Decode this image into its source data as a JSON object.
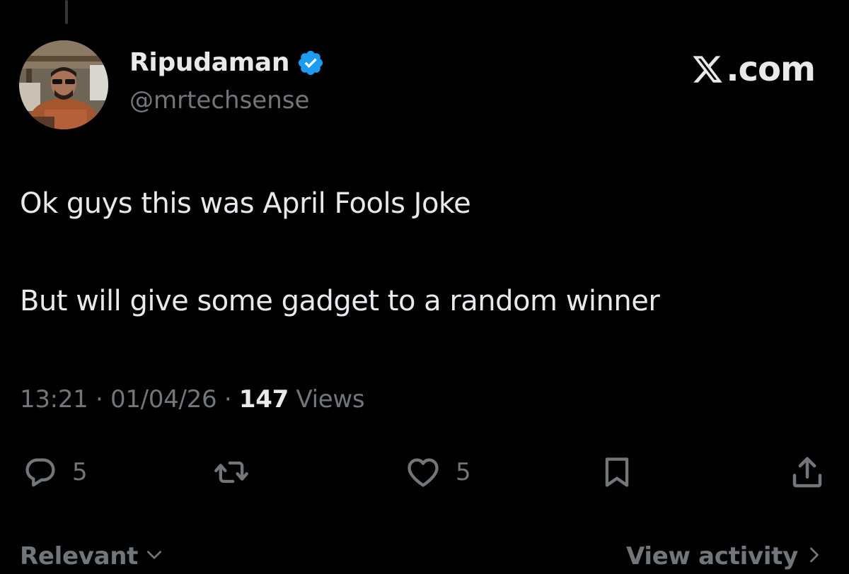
{
  "post": {
    "author": {
      "display_name": "Ripudaman",
      "handle": "@mrtechsense",
      "verified": true,
      "verified_color": "#1d9bf0"
    },
    "brand": {
      "text": ".com",
      "icon": "x-logo-icon"
    },
    "text_lines": [
      "Ok guys this was April Fools Joke",
      "But will give some gadget to a random winner"
    ],
    "meta": {
      "time": "13:21",
      "separator": " · ",
      "date": "01/04/26",
      "views_count": "147",
      "views_label": " Views"
    },
    "actions": {
      "reply_count": "5",
      "like_count": "5",
      "reply_icon": "reply-icon",
      "repost_icon": "repost-icon",
      "like_icon": "heart-icon",
      "bookmark_icon": "bookmark-icon",
      "share_icon": "share-icon"
    }
  },
  "footer": {
    "sort_label": "Relevant",
    "activity_label": "View activity"
  },
  "colors": {
    "background": "#000000",
    "primary_text": "#e7e9ea",
    "secondary_text": "#71767b"
  }
}
